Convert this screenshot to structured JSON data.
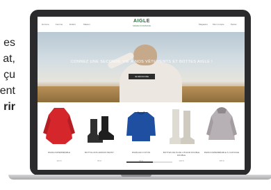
{
  "side_text": {
    "lines": [
      "es",
      "at,",
      "çu",
      "ent",
      "rir"
    ]
  },
  "site": {
    "logo": "AIGLE",
    "logo_sub": "MADE IN FRANCE",
    "nav_left": [
      "Homme",
      "Femme",
      "Enfant",
      "Maison"
    ],
    "nav_right": [
      "Magasins",
      "Mon compte",
      "Panier"
    ]
  },
  "hero": {
    "headline": "CONNEZ UNE SECONDE VIE À NOS VÊTEMENTS ET BOTTES AIGLE !",
    "cta": "JE DÉCOUVRE"
  },
  "products": [
    {
      "label": "PARKA IMPERMÉABLE",
      "price": "110 €",
      "color": "#d5262c"
    },
    {
      "label": "BOTTILLONS ARROW PENNY",
      "price": "95 €",
      "color": "#2f2f2f"
    },
    {
      "label": "PARKA EN COTON",
      "price": "65 €",
      "color": "#1f4fa0"
    },
    {
      "label": "BOTTES DE PLUIE LITHIUM DOUBLE DOUBLE",
      "price": "130 €",
      "color": "#d9d6cc"
    },
    {
      "label": "PARKA IMPERMÉABLE À CAPUCHE",
      "price": "165 €",
      "color": "#b7b0b4"
    }
  ]
}
